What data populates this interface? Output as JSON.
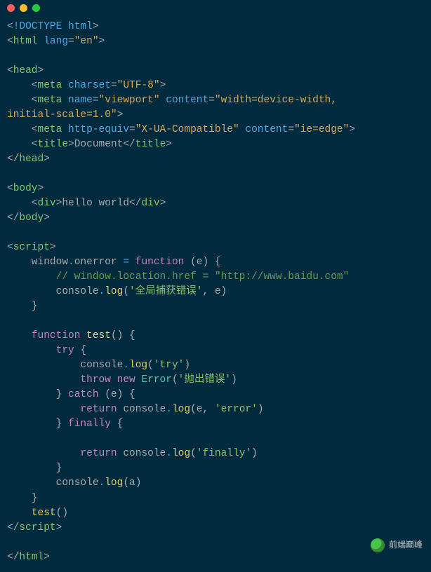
{
  "titlebar": {
    "dots": [
      "red",
      "yellow",
      "green"
    ]
  },
  "code": {
    "tokens": [
      [
        [
          "gy",
          "<"
        ],
        [
          "bl",
          "!DOCTYPE html"
        ],
        [
          "gy",
          ">"
        ]
      ],
      [
        [
          "gy",
          "<"
        ],
        [
          "tg",
          "html"
        ],
        [
          "gy",
          " "
        ],
        [
          "bl",
          "lang"
        ],
        [
          "gy",
          "="
        ],
        [
          "or",
          "\"en\""
        ],
        [
          "gy",
          ">"
        ]
      ],
      [],
      [
        [
          "gy",
          "<"
        ],
        [
          "tg",
          "head"
        ],
        [
          "gy",
          ">"
        ]
      ],
      [
        [
          "gy",
          "    <"
        ],
        [
          "tg",
          "meta"
        ],
        [
          "gy",
          " "
        ],
        [
          "bl",
          "charset"
        ],
        [
          "gy",
          "="
        ],
        [
          "or",
          "\"UTF-8\""
        ],
        [
          "gy",
          ">"
        ]
      ],
      [
        [
          "gy",
          "    <"
        ],
        [
          "tg",
          "meta"
        ],
        [
          "gy",
          " "
        ],
        [
          "bl",
          "name"
        ],
        [
          "gy",
          "="
        ],
        [
          "or",
          "\"viewport\""
        ],
        [
          "gy",
          " "
        ],
        [
          "bl",
          "content"
        ],
        [
          "gy",
          "="
        ],
        [
          "or",
          "\"width=device-width, "
        ]
      ],
      [
        [
          "or",
          "initial-scale=1.0\""
        ],
        [
          "gy",
          ">"
        ]
      ],
      [
        [
          "gy",
          "    <"
        ],
        [
          "tg",
          "meta"
        ],
        [
          "gy",
          " "
        ],
        [
          "bl",
          "http-equiv"
        ],
        [
          "gy",
          "="
        ],
        [
          "or",
          "\"X-UA-Compatible\""
        ],
        [
          "gy",
          " "
        ],
        [
          "bl",
          "content"
        ],
        [
          "gy",
          "="
        ],
        [
          "or",
          "\"ie=edge\""
        ],
        [
          "gy",
          ">"
        ]
      ],
      [
        [
          "gy",
          "    <"
        ],
        [
          "tg",
          "title"
        ],
        [
          "gy",
          ">"
        ],
        [
          "gy",
          "Document"
        ],
        [
          "gy",
          "</"
        ],
        [
          "tg",
          "title"
        ],
        [
          "gy",
          ">"
        ]
      ],
      [
        [
          "gy",
          "</"
        ],
        [
          "tg",
          "head"
        ],
        [
          "gy",
          ">"
        ]
      ],
      [],
      [
        [
          "gy",
          "<"
        ],
        [
          "tg",
          "body"
        ],
        [
          "gy",
          ">"
        ]
      ],
      [
        [
          "gy",
          "    <"
        ],
        [
          "tg",
          "div"
        ],
        [
          "gy",
          ">"
        ],
        [
          "gy",
          "hello world"
        ],
        [
          "gy",
          "</"
        ],
        [
          "tg",
          "div"
        ],
        [
          "gy",
          ">"
        ]
      ],
      [
        [
          "gy",
          "</"
        ],
        [
          "tg",
          "body"
        ],
        [
          "gy",
          ">"
        ]
      ],
      [],
      [
        [
          "gy",
          "<"
        ],
        [
          "tg",
          "script"
        ],
        [
          "gy",
          ">"
        ]
      ],
      [
        [
          "gy",
          "    window"
        ],
        [
          "bl",
          "."
        ],
        [
          "gy",
          "onerror "
        ],
        [
          "bl",
          "="
        ],
        [
          "gy",
          " "
        ],
        [
          "kw",
          "function"
        ],
        [
          "gy",
          " (e) {"
        ]
      ],
      [
        [
          "gy",
          "        "
        ],
        [
          "cm",
          "// window.location.href = \"http://www.baidu.com\""
        ]
      ],
      [
        [
          "gy",
          "        console"
        ],
        [
          "bl",
          "."
        ],
        [
          "yl",
          "log"
        ],
        [
          "gy",
          "("
        ],
        [
          "gr",
          "'全局捕获错误'"
        ],
        [
          "gy",
          ", e)"
        ]
      ],
      [
        [
          "gy",
          "    }"
        ]
      ],
      [],
      [
        [
          "gy",
          "    "
        ],
        [
          "kw",
          "function"
        ],
        [
          "gy",
          " "
        ],
        [
          "fn",
          "test"
        ],
        [
          "gy",
          "() {"
        ]
      ],
      [
        [
          "gy",
          "        "
        ],
        [
          "kw",
          "try"
        ],
        [
          "gy",
          " {"
        ]
      ],
      [
        [
          "gy",
          "            console"
        ],
        [
          "bl",
          "."
        ],
        [
          "yl",
          "log"
        ],
        [
          "gy",
          "("
        ],
        [
          "gr",
          "'try'"
        ],
        [
          "gy",
          ")"
        ]
      ],
      [
        [
          "gy",
          "            "
        ],
        [
          "kw",
          "throw"
        ],
        [
          "gy",
          " "
        ],
        [
          "kw",
          "new"
        ],
        [
          "gy",
          " "
        ],
        [
          "cy",
          "Error"
        ],
        [
          "gy",
          "("
        ],
        [
          "gr",
          "'抛出错误'"
        ],
        [
          "gy",
          ")"
        ]
      ],
      [
        [
          "gy",
          "        } "
        ],
        [
          "kw",
          "catch"
        ],
        [
          "gy",
          " (e) {"
        ]
      ],
      [
        [
          "gy",
          "            "
        ],
        [
          "kw",
          "return"
        ],
        [
          "gy",
          " console"
        ],
        [
          "bl",
          "."
        ],
        [
          "yl",
          "log"
        ],
        [
          "gy",
          "(e, "
        ],
        [
          "gr",
          "'error'"
        ],
        [
          "gy",
          ")"
        ]
      ],
      [
        [
          "gy",
          "        } "
        ],
        [
          "kw",
          "finally"
        ],
        [
          "gy",
          " {"
        ]
      ],
      [],
      [
        [
          "gy",
          "            "
        ],
        [
          "kw",
          "return"
        ],
        [
          "gy",
          " console"
        ],
        [
          "bl",
          "."
        ],
        [
          "yl",
          "log"
        ],
        [
          "gy",
          "("
        ],
        [
          "gr",
          "'finally'"
        ],
        [
          "gy",
          ")"
        ]
      ],
      [
        [
          "gy",
          "        }"
        ]
      ],
      [
        [
          "gy",
          "        console"
        ],
        [
          "bl",
          "."
        ],
        [
          "yl",
          "log"
        ],
        [
          "gy",
          "(a)"
        ]
      ],
      [
        [
          "gy",
          "    }"
        ]
      ],
      [
        [
          "gy",
          "    "
        ],
        [
          "yl",
          "test"
        ],
        [
          "gy",
          "()"
        ]
      ],
      [
        [
          "gy",
          "</"
        ],
        [
          "tg",
          "script"
        ],
        [
          "gy",
          ">"
        ]
      ],
      [],
      [
        [
          "gy",
          "</"
        ],
        [
          "tg",
          "html"
        ],
        [
          "gy",
          ">"
        ]
      ]
    ]
  },
  "watermark": {
    "label": "前端巅峰",
    "icon": "wechat-icon"
  }
}
